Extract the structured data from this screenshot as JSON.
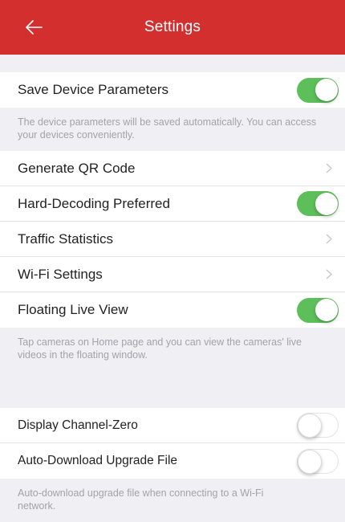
{
  "header": {
    "title": "Settings"
  },
  "group1": {
    "save_device_parameters": {
      "label": "Save Device Parameters",
      "enabled": true
    }
  },
  "notes": {
    "save_params": "The device parameters will be saved automatically. You can access your devices conveniently.",
    "floating_view": "Tap cameras on Home page and you can view the cameras' live videos in the floating window.",
    "auto_download": "Auto-download upgrade file when connecting to a Wi-Fi network."
  },
  "group2": {
    "generate_qr": {
      "label": "Generate QR Code"
    },
    "hard_decoding": {
      "label": "Hard-Decoding Preferred",
      "enabled": true
    },
    "traffic_stats": {
      "label": "Traffic Statistics"
    },
    "wifi_settings": {
      "label": "Wi-Fi Settings"
    },
    "floating_live_view": {
      "label": "Floating Live View",
      "enabled": true
    }
  },
  "group3": {
    "display_channel_zero": {
      "label": "Display Channel-Zero",
      "enabled": false
    },
    "auto_download_upgrade": {
      "label": "Auto-Download Upgrade File",
      "enabled": false
    }
  },
  "colors": {
    "header_bg": "#d32f2f",
    "toggle_on": "#5cbf5a",
    "page_bg": "#efeff4"
  },
  "icons": {
    "back": "arrow-left-icon",
    "disclosure": "chevron-right-icon"
  }
}
